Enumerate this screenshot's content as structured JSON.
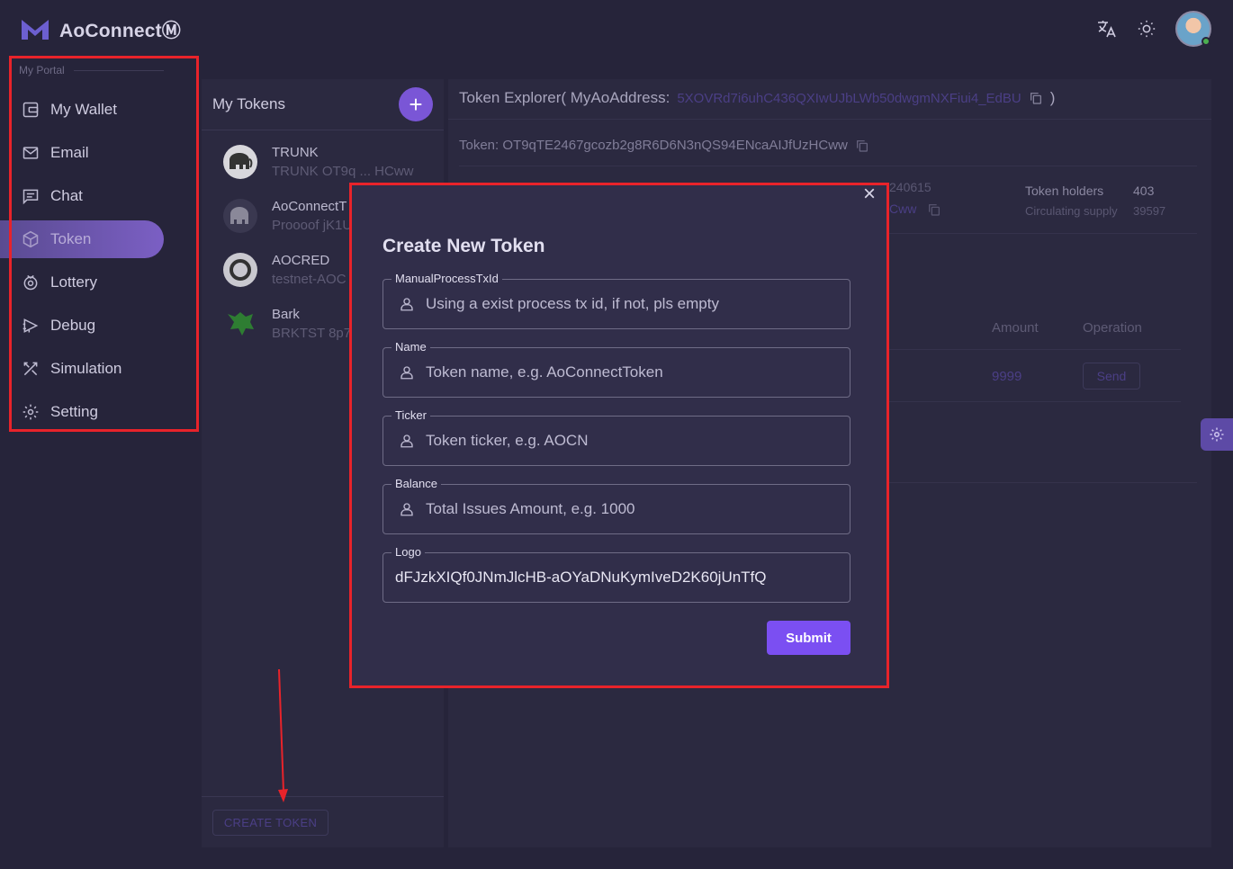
{
  "app": {
    "title": "AoConnectⓂ"
  },
  "sidebar": {
    "section": "My Portal",
    "items": [
      {
        "label": "My Wallet",
        "icon": "wallet-icon"
      },
      {
        "label": "Email",
        "icon": "mail-icon"
      },
      {
        "label": "Chat",
        "icon": "chat-icon"
      },
      {
        "label": "Token",
        "icon": "token-icon",
        "active": true
      },
      {
        "label": "Lottery",
        "icon": "lottery-icon"
      },
      {
        "label": "Debug",
        "icon": "bug-icon"
      },
      {
        "label": "Simulation",
        "icon": "tools-icon"
      },
      {
        "label": "Setting",
        "icon": "gear-icon"
      }
    ]
  },
  "tokens": {
    "title": "My Tokens",
    "add_label": "+",
    "list": [
      {
        "name": "TRUNK",
        "sub": "TRUNK OT9q ... HCww"
      },
      {
        "name": "AoConnectT",
        "sub": "Proooof jK1U"
      },
      {
        "name": "AOCRED",
        "sub": "testnet-AOC"
      },
      {
        "name": "Bark",
        "sub": "BRKTST 8p7"
      }
    ],
    "create_label": "CREATE TOKEN"
  },
  "explorer": {
    "title_prefix": "Token Explorer( MyAoAddress:",
    "address": "5XOVRd7i6uhC436QXIwUJbLWb50dwgmNXFiui4_EdBU",
    "title_suffix": ")",
    "token_line": "Token: OT9qTE2467gcozb2g8R6D6N3nQS94ENcaAIJfUzHCww",
    "partial_num": "240615",
    "partial_link": "Cww",
    "holders_label": "Token holders",
    "holders_value": "403",
    "supply_label": "Circulating supply",
    "supply_value": "39597",
    "col_amount": "Amount",
    "col_operation": "Operation",
    "row_amount": "9999",
    "row_send": "Send"
  },
  "modal": {
    "title": "Create New Token",
    "close": "×",
    "fields": [
      {
        "label": "ManualProcessTxId",
        "placeholder": "Using a exist process tx id, if not, pls empty",
        "icon": "user-icon"
      },
      {
        "label": "Name",
        "placeholder": "Token name, e.g. AoConnectToken",
        "icon": "user-icon"
      },
      {
        "label": "Ticker",
        "placeholder": "Token ticker, e.g. AOCN",
        "icon": "user-icon"
      },
      {
        "label": "Balance",
        "placeholder": "Total Issues Amount, e.g. 1000",
        "icon": "user-icon"
      },
      {
        "label": "Logo",
        "value": "dFJzkXIQf0JNmJlcHB-aOYaDNuKymIveD2K60jUnTfQ"
      }
    ],
    "submit": "Submit"
  },
  "colors": {
    "accent": "#7b4ff2",
    "annotation": "#e8232a",
    "background": "#26243a"
  }
}
